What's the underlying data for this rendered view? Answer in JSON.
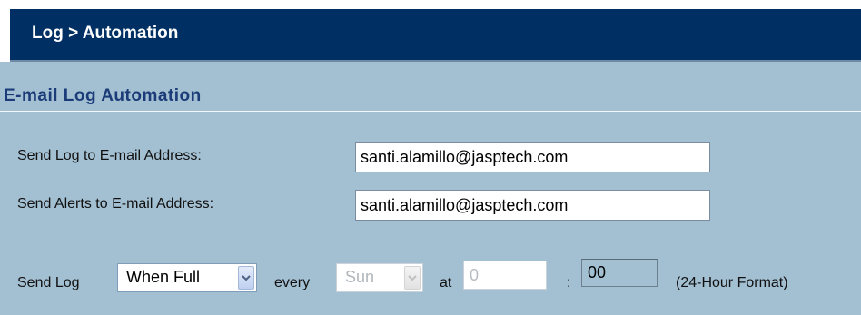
{
  "header": {
    "title": "Log > Automation"
  },
  "section": {
    "title": "E-mail Log Automation"
  },
  "form": {
    "send_log_label": "Send Log to E-mail Address:",
    "send_log_value": "santi.alamillo@jasptech.com",
    "send_alerts_label": "Send Alerts to E-mail Address:",
    "send_alerts_value": "santi.alamillo@jasptech.com",
    "schedule": {
      "send_log_label": "Send Log",
      "frequency_selected": "When Full",
      "every_label": "every",
      "day_selected": "Sun",
      "at_label": "at",
      "hour_value": "0",
      "colon": ":",
      "minute_value": "00",
      "format_note": "(24-Hour Format)"
    }
  },
  "colors": {
    "header_bg": "#003063",
    "panel_bg": "#a3bfd2",
    "section_title": "#1b3c78"
  }
}
